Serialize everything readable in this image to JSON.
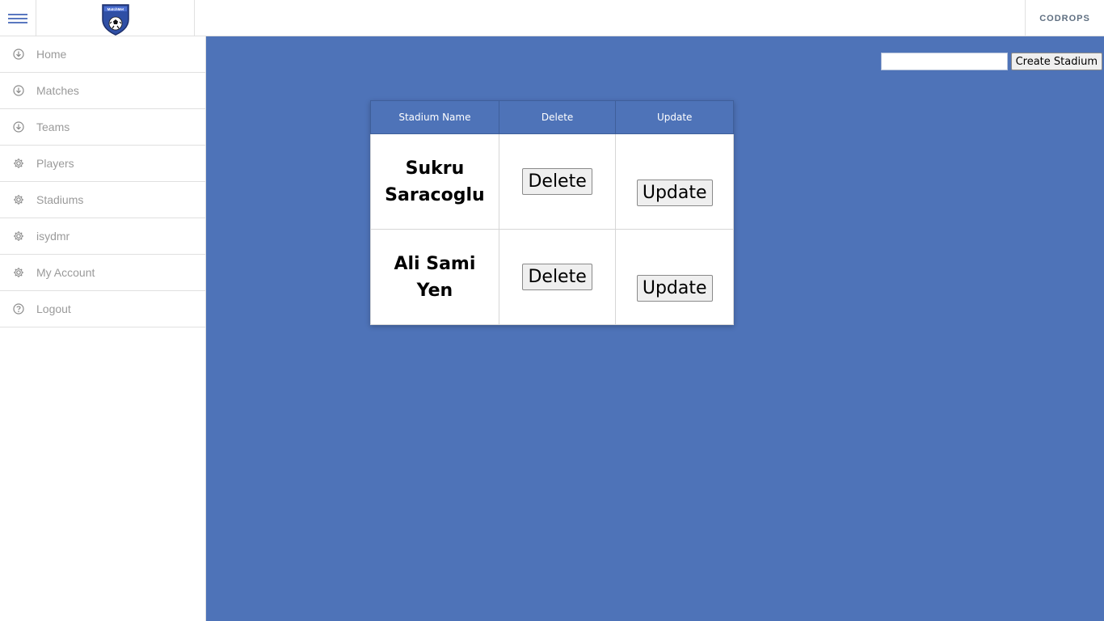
{
  "header": {
    "logo_text": "MatchMe!",
    "right_link": "CODROPS"
  },
  "sidebar": {
    "items": [
      {
        "label": "Home",
        "icon": "download-circle-icon"
      },
      {
        "label": "Matches",
        "icon": "download-circle-icon"
      },
      {
        "label": "Teams",
        "icon": "download-circle-icon"
      },
      {
        "label": "Players",
        "icon": "gear-icon"
      },
      {
        "label": "Stadiums",
        "icon": "gear-icon"
      },
      {
        "label": "isydmr",
        "icon": "gear-icon"
      },
      {
        "label": "My Account",
        "icon": "gear-icon"
      },
      {
        "label": "Logout",
        "icon": "help-circle-icon"
      }
    ]
  },
  "create": {
    "input_value": "",
    "button_label": "Create Stadium"
  },
  "table": {
    "headers": [
      "Stadium Name",
      "Delete",
      "Update"
    ],
    "rows": [
      {
        "name": "Sukru Saracoglu",
        "delete_label": "Delete",
        "update_label": "Update"
      },
      {
        "name": "Ali Sami Yen",
        "delete_label": "Delete",
        "update_label": "Update"
      }
    ]
  },
  "colors": {
    "main_bg": "#4e73b8",
    "accent": "#5a78c0"
  }
}
